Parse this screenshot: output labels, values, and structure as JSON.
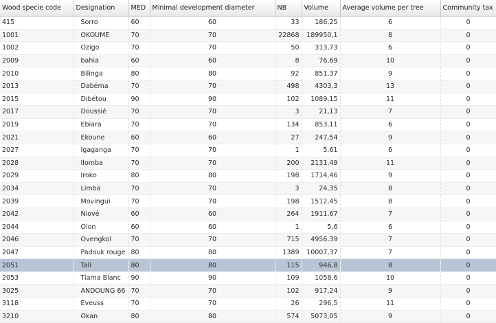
{
  "columns": [
    "Wood specie code",
    "Designation",
    "MED",
    "Minimal development diameter",
    "NB",
    "Volume",
    "Average volume per tree",
    "Community tax"
  ],
  "selected_row": 20,
  "rows": [
    [
      "415",
      "Sorro",
      "60",
      "60",
      "33",
      "186,25",
      "6",
      "0"
    ],
    [
      "1001",
      "OKOUME",
      "70",
      "70",
      "22868",
      "189950,1",
      "8",
      "0"
    ],
    [
      "1002",
      "Ozigo",
      "70",
      "70",
      "50",
      "313,73",
      "6",
      "0"
    ],
    [
      "2009",
      "bahia",
      "60",
      "60",
      "8",
      "76,69",
      "10",
      "0"
    ],
    [
      "2010",
      "Bilinga",
      "80",
      "80",
      "92",
      "851,37",
      "9",
      "0"
    ],
    [
      "2013",
      "Dabéma",
      "70",
      "70",
      "498",
      "4303,3",
      "13",
      "0"
    ],
    [
      "2015",
      "Dibétou",
      "90",
      "90",
      "102",
      "1089,15",
      "11",
      "0"
    ],
    [
      "2017",
      "Doussié",
      "70",
      "70",
      "3",
      "21,13",
      "7",
      "0"
    ],
    [
      "2019",
      "Ebiara",
      "70",
      "70",
      "134",
      "853,11",
      "6",
      "0"
    ],
    [
      "2021",
      "Ekoune",
      "60",
      "60",
      "27",
      "247,54",
      "9",
      "0"
    ],
    [
      "2027",
      "Igaganga",
      "70",
      "70",
      "1",
      "5,61",
      "6",
      "0"
    ],
    [
      "2028",
      "Ilomba",
      "70",
      "70",
      "200",
      "2131,49",
      "11",
      "0"
    ],
    [
      "2029",
      "Iroko",
      "80",
      "80",
      "198",
      "1714,46",
      "9",
      "0"
    ],
    [
      "2034",
      "Limba",
      "70",
      "70",
      "3",
      "24,35",
      "8",
      "0"
    ],
    [
      "2039",
      "Movingui",
      "70",
      "70",
      "198",
      "1512,45",
      "8",
      "0"
    ],
    [
      "2042",
      "Niové",
      "60",
      "60",
      "264",
      "1911,67",
      "7",
      "0"
    ],
    [
      "2044",
      "Olon",
      "60",
      "60",
      "1",
      "5,6",
      "6",
      "0"
    ],
    [
      "2046",
      "Ovengkol",
      "70",
      "70",
      "715",
      "4956,39",
      "7",
      "0"
    ],
    [
      "2047",
      "Padouk rouge",
      "80",
      "80",
      "1389",
      "10007,37",
      "7",
      "0"
    ],
    [
      "2051",
      "Tali",
      "80",
      "80",
      "115",
      "946,8",
      "8",
      "0"
    ],
    [
      "2053",
      "Tiama Blanc",
      "90",
      "90",
      "109",
      "1058,6",
      "10",
      "0"
    ],
    [
      "3025",
      "ANDOUNG 66",
      "70",
      "70",
      "102",
      "917,24",
      "9",
      "0"
    ],
    [
      "3118",
      "Eveuss",
      "70",
      "70",
      "26",
      "296,5",
      "11",
      "0"
    ],
    [
      "3210",
      "Okan",
      "80",
      "80",
      "574",
      "5073,05",
      "9",
      "0"
    ]
  ]
}
